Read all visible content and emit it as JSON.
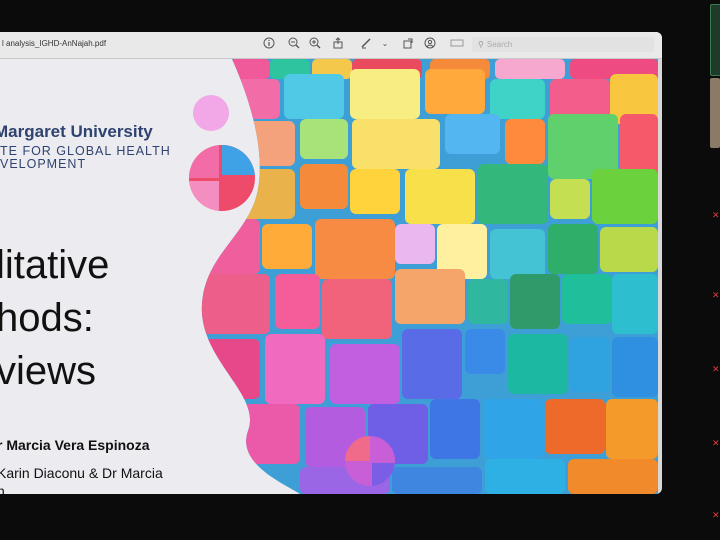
{
  "viewer": {
    "filename": "l analysis_IGHD-AnNajah.pdf",
    "search_placeholder": "Search",
    "icons": [
      "info-icon",
      "zoom-out-icon",
      "zoom-in-icon",
      "share-icon",
      "markup-icon",
      "chevron-down-icon",
      "rotate-icon",
      "highlight-icon",
      "redact-icon",
      "search-icon"
    ]
  },
  "slide": {
    "university": "Margaret University",
    "institute_line1": "TE FOR GLOBAL HEALTH",
    "institute_line2": "VELOPMENT",
    "title_line1": "litative",
    "title_line2": "hods:",
    "title_line3": "views",
    "presenter": "r Marcia Vera Espinoza",
    "coauthors_line1": "Karin Diaconu & Dr Marcia",
    "coauthors_line2": "n"
  },
  "colors": {
    "brand_navy": "#2f4370",
    "slide_bg": "#ececf0",
    "mic_muted": "#e23b3b"
  }
}
